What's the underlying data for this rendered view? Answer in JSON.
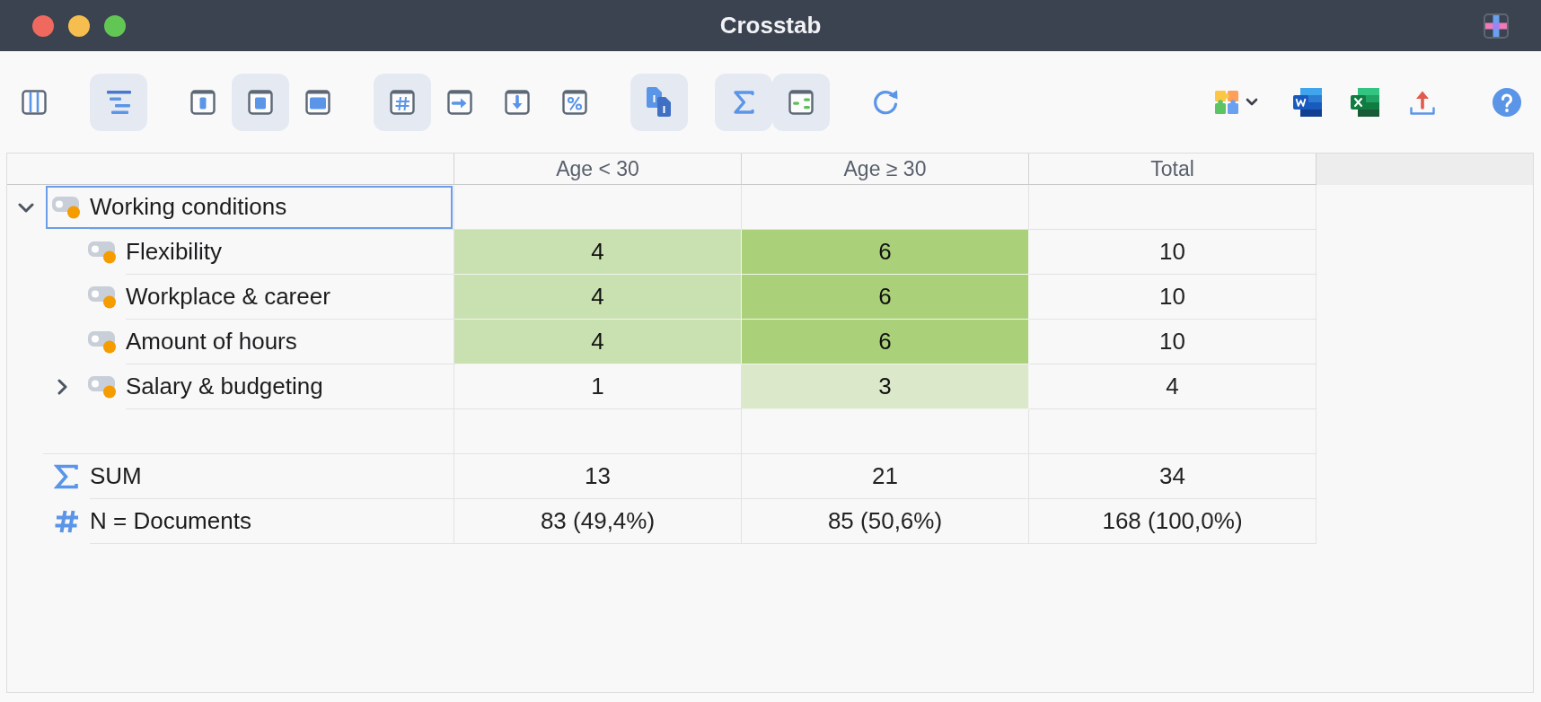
{
  "window": {
    "title": "Crosstab"
  },
  "toolbar": {
    "groups": [
      {
        "buttons": [
          {
            "selected": false
          }
        ]
      },
      {
        "buttons": [
          {
            "selected": true
          }
        ]
      },
      {
        "buttons": [
          {
            "selected": false
          },
          {
            "selected": true
          },
          {
            "selected": false
          }
        ]
      },
      {
        "buttons": [
          {
            "selected": true
          },
          {
            "selected": false
          },
          {
            "selected": false
          },
          {
            "selected": false
          }
        ]
      },
      {
        "buttons": [
          {
            "selected": true
          }
        ]
      },
      {
        "buttons": [
          {
            "selected": true
          },
          {
            "selected": true
          }
        ]
      }
    ]
  },
  "table": {
    "columns": [
      "Age < 30",
      "Age ≥ 30",
      "Total"
    ],
    "rows": [
      {
        "label": "Working conditions",
        "expanded": true,
        "selected": true,
        "children": [
          {
            "label": "Flexibility",
            "selected": false,
            "cells": [
              {
                "value": "4",
                "color": "#c9e0b0"
              },
              {
                "value": "6",
                "color": "#aad17a"
              },
              {
                "value": "10"
              }
            ]
          },
          {
            "label": "Workplace & career",
            "selected": false,
            "cells": [
              {
                "value": "4",
                "color": "#c9e0b0"
              },
              {
                "value": "6",
                "color": "#aad17a"
              },
              {
                "value": "10"
              }
            ]
          },
          {
            "label": "Amount of hours",
            "selected": false,
            "cells": [
              {
                "value": "4",
                "color": "#c9e0b0"
              },
              {
                "value": "6",
                "color": "#aad17a"
              },
              {
                "value": "10"
              }
            ]
          },
          {
            "label": "Salary & budgeting",
            "expanded": false,
            "selected": false,
            "cells": [
              {
                "value": "1"
              },
              {
                "value": "3",
                "color": "#dce8ca"
              },
              {
                "value": "4"
              }
            ]
          }
        ]
      }
    ],
    "summary": [
      {
        "kind": "sum",
        "label": "SUM",
        "cells": [
          "13",
          "21",
          "34"
        ]
      },
      {
        "kind": "count",
        "label": "N = Documents",
        "cells": [
          "83 (49,4%)",
          "85 (50,6%)",
          "168 (100,0%)"
        ]
      }
    ]
  }
}
